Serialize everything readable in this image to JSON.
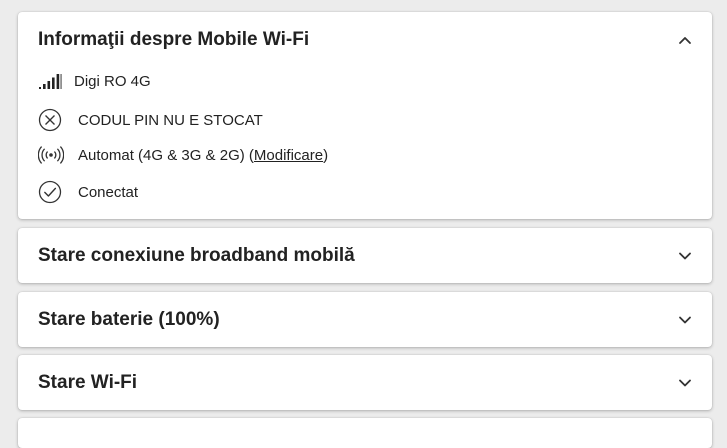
{
  "panels": {
    "mobile_wifi_info": {
      "title": "Informaţii despre Mobile Wi-Fi",
      "expanded": true,
      "items": {
        "network": {
          "icon": "signal-bars-icon",
          "text": "Digi RO 4G"
        },
        "pin": {
          "icon": "x-circle-icon",
          "text": "CODUL PIN NU E STOCAT"
        },
        "mode": {
          "icon": "antenna-broadcast-icon",
          "text": "Automat (4G & 3G & 2G) (",
          "link": "Modificare",
          "text_after": ")"
        },
        "status": {
          "icon": "check-circle-icon",
          "text": "Conectat"
        }
      }
    },
    "broadband_status": {
      "title": "Stare conexiune broadband mobilă",
      "expanded": false
    },
    "battery_status": {
      "title": "Stare baterie (100%)",
      "expanded": false
    },
    "wifi_status": {
      "title": "Stare Wi-Fi",
      "expanded": false
    }
  }
}
